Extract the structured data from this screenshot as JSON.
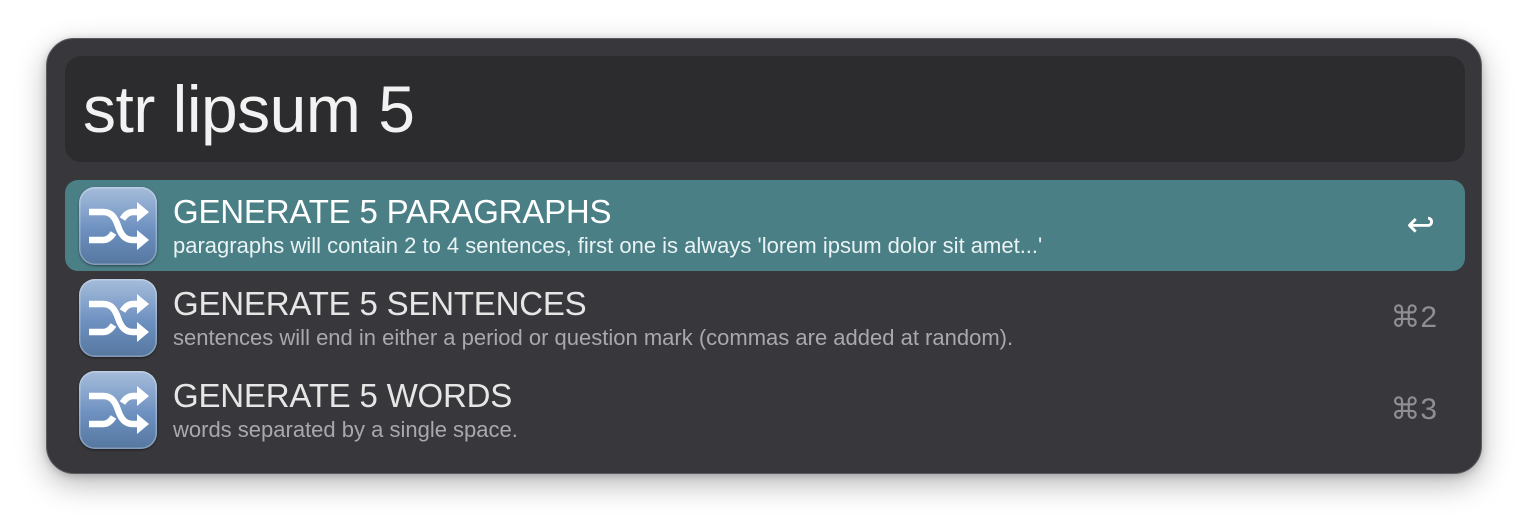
{
  "search": {
    "query": "str lipsum 5"
  },
  "results": [
    {
      "title": "GENERATE 5 PARAGRAPHS",
      "subtitle": "paragraphs will contain 2 to 4 sentences, first one is always 'lorem ipsum dolor sit amet...'",
      "shortcut": "↩",
      "icon": "shuffle-icon",
      "selected": true
    },
    {
      "title": "GENERATE 5 SENTENCES",
      "subtitle": "sentences will end in either a period or question mark (commas are added at random).",
      "shortcut": "⌘2",
      "icon": "shuffle-icon",
      "selected": false
    },
    {
      "title": "GENERATE 5 WORDS",
      "subtitle": "words separated by a single space.",
      "shortcut": "⌘3",
      "icon": "shuffle-icon",
      "selected": false
    }
  ],
  "colors": {
    "window_background": "#38383c",
    "search_background": "#2c2c2f",
    "selection": "#4a7f86"
  }
}
